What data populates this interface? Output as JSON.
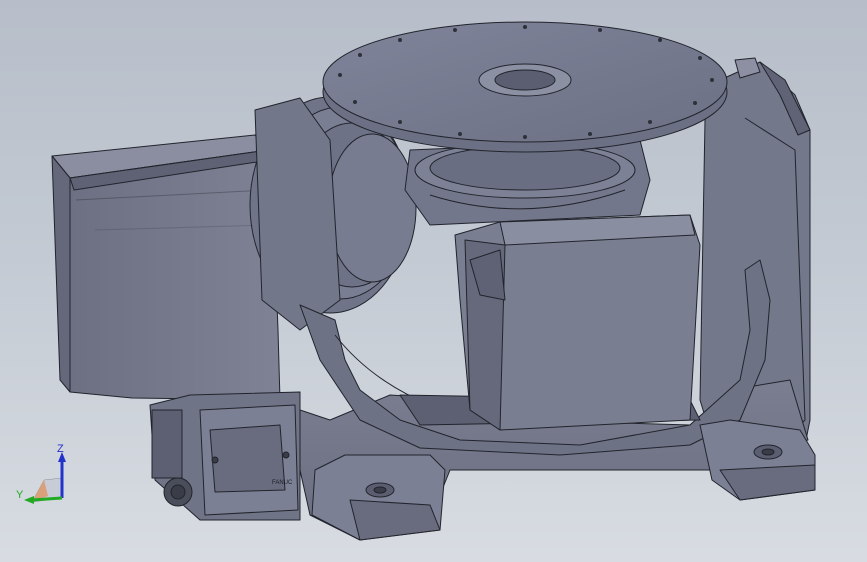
{
  "viewport": {
    "background_top": "#b7bec9",
    "background_bottom": "#d8dce2",
    "model_face_color": "#767a8c",
    "model_edge_color": "#22242c"
  },
  "triad": {
    "z_label": "Z",
    "y_label": "Y",
    "z_color": "#2233cc",
    "y_color": "#22aa22"
  },
  "model": {
    "nameplate_text": "FANUC"
  }
}
